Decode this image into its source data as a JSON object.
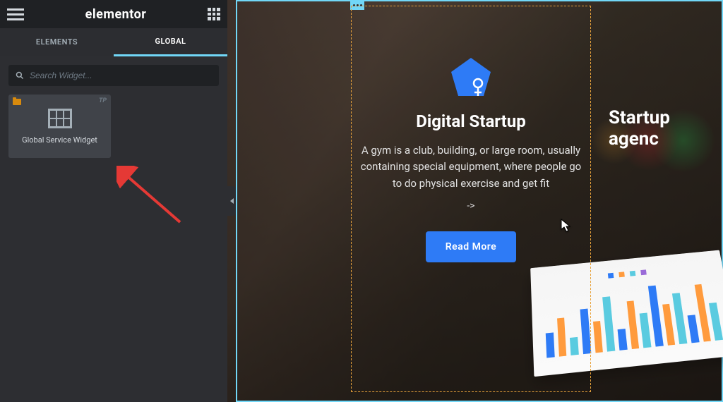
{
  "header": {
    "logo": "elementor"
  },
  "tabs": {
    "elements": "ELEMENTS",
    "global": "GLOBAL",
    "active": "global"
  },
  "search": {
    "placeholder": "Search Widget..."
  },
  "widgets": [
    {
      "label": "Global Service Widget",
      "badge": "TP",
      "icon": "grid-icon"
    }
  ],
  "preview": {
    "card1": {
      "icon": "female-icon",
      "title": "Digital Startup",
      "description": "A gym is a club, building, or large room, usually containing special equipment, where people go to do physical exercise and get fit",
      "arrow": "->",
      "button": "Read More"
    },
    "card2": {
      "title": "Startup agenc"
    }
  },
  "colors": {
    "accent": "#71d7f7",
    "button": "#2e7bf6",
    "highlight": "#e8a23b"
  }
}
